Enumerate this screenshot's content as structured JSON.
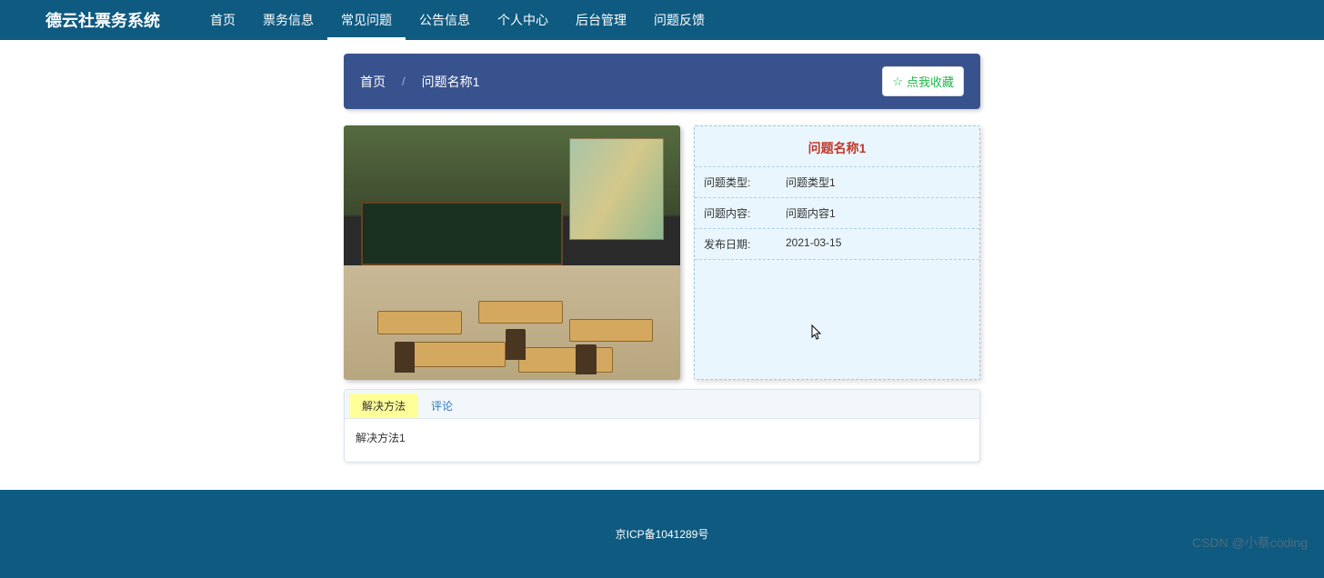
{
  "brand": "德云社票务系统",
  "nav": [
    {
      "label": "首页"
    },
    {
      "label": "票务信息"
    },
    {
      "label": "常见问题",
      "active": true
    },
    {
      "label": "公告信息"
    },
    {
      "label": "个人中心"
    },
    {
      "label": "后台管理"
    },
    {
      "label": "问题反馈"
    }
  ],
  "breadcrumb": {
    "home": "首页",
    "sep": "/",
    "current": "问题名称1"
  },
  "favorite_button": "点我收藏",
  "detail": {
    "title": "问题名称1",
    "rows": [
      {
        "label": "问题类型:",
        "value": "问题类型1"
      },
      {
        "label": "问题内容:",
        "value": "问题内容1"
      },
      {
        "label": "发布日期:",
        "value": "2021-03-15"
      }
    ]
  },
  "tabs": [
    {
      "label": "解决方法",
      "active": true
    },
    {
      "label": "评论"
    }
  ],
  "solution_content": "解决方法1",
  "footer": "京ICP备1041289号",
  "watermark": "CSDN @小蔡coding"
}
